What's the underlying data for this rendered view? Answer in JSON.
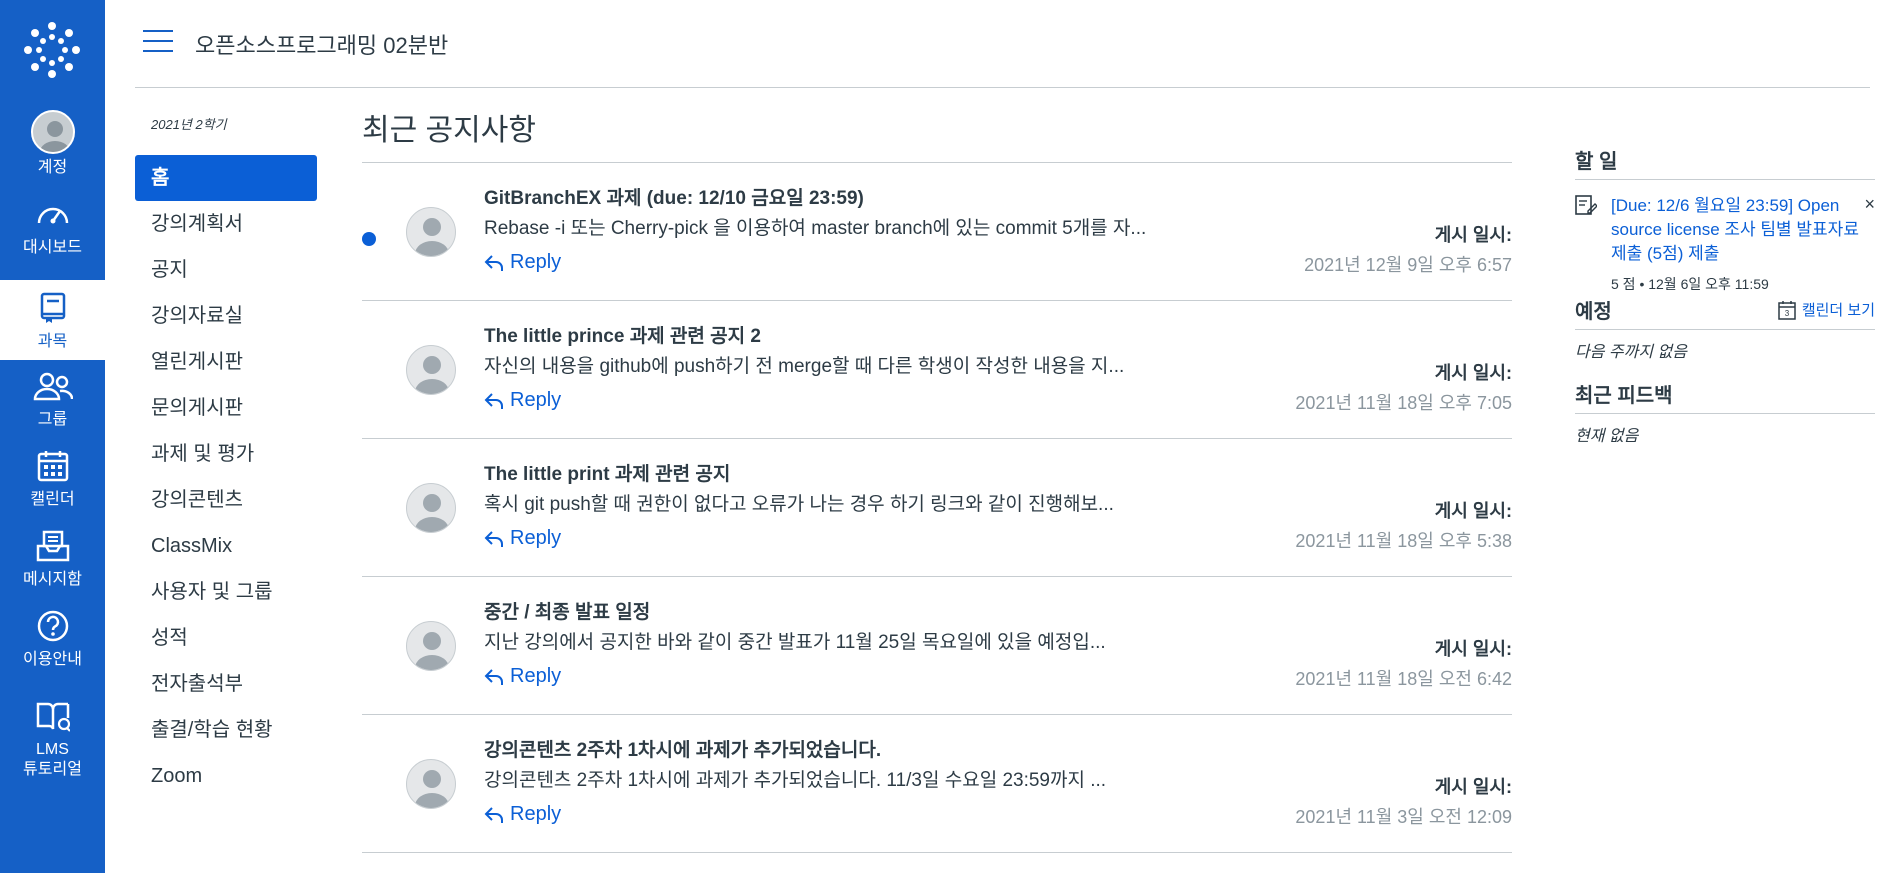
{
  "global_nav": {
    "items": [
      {
        "label": "계정",
        "icon": "avatar"
      },
      {
        "label": "대시보드",
        "icon": "dashboard-icon"
      },
      {
        "label": "과목",
        "icon": "courses-icon"
      },
      {
        "label": "그룹",
        "icon": "groups-icon"
      },
      {
        "label": "캘린더",
        "icon": "calendar-icon"
      },
      {
        "label": "메시지함",
        "icon": "inbox-icon"
      },
      {
        "label": "이용안내",
        "icon": "help-icon"
      },
      {
        "label": "LMS\n튜토리얼",
        "icon": "tutorial-icon"
      }
    ],
    "active_index": 2
  },
  "header": {
    "course_title": "오픈소스프로그래밍 02분반"
  },
  "course_nav": {
    "term": "2021년 2학기",
    "links": [
      "홈",
      "강의계획서",
      "공지",
      "강의자료실",
      "열린게시판",
      "문의게시판",
      "과제 및 평가",
      "강의콘텐츠",
      "ClassMix",
      "사용자 및 그룹",
      "성적",
      "전자출석부",
      "출결/학습 현황",
      "Zoom"
    ],
    "active_index": 0
  },
  "main": {
    "title": "최근 공지사항",
    "reply_label": "Reply",
    "posted_label": "게시 일시:",
    "announcements": [
      {
        "title": "GitBranchEX 과제 (due: 12/10 금요일 23:59)",
        "message": "Rebase -i 또는 Cherry-pick 을 이용하여 master branch에 있는 commit 5개를 자...",
        "date": "2021년 12월 9일 오후 6:57",
        "unread": true
      },
      {
        "title": "The little prince 과제 관련 공지 2",
        "message": "자신의 내용을 github에 push하기 전 merge할 때 다른 학생이 작성한 내용을 지...",
        "date": "2021년 11월 18일 오후 7:05",
        "unread": false
      },
      {
        "title": "The little print 과제 관련 공지",
        "message": "혹시 git push할 때 권한이 없다고 오류가 나는 경우 하기 링크와 같이 진행해보...",
        "date": "2021년 11월 18일 오후 5:38",
        "unread": false
      },
      {
        "title": "중간 / 최종 발표 일정",
        "message": "지난 강의에서 공지한 바와 같이 중간 발표가 11월 25일 목요일에 있을 예정입...",
        "date": "2021년 11월 18일 오전 6:42",
        "unread": false
      },
      {
        "title": "강의콘텐츠 2주차 1차시에 과제가 추가되었습니다.",
        "message": "강의콘텐츠 2주차 1차시에 과제가 추가되었습니다. 11/3일 수요일 23:59까지 ...",
        "date": "2021년 11월 3일 오전 12:09",
        "unread": false
      }
    ]
  },
  "sidebar": {
    "todo_heading": "할 일",
    "todo_item": {
      "link": "[Due: 12/6 월요일 23:59] Open source license 조사 팀별 발표자료 제출 (5점) 제출",
      "meta": "5 점 • 12월 6일 오후 11:59",
      "close": "×"
    },
    "upcoming_heading": "예정",
    "calendar_link": "캘린더 보기",
    "calendar_day": "3",
    "upcoming_empty": "다음 주까지 없음",
    "feedback_heading": "최근 피드백",
    "feedback_empty": "현재 없음"
  },
  "colors": {
    "nav_bg": "#1560c6",
    "accent": "#0b5fd6",
    "muted": "#8b969e"
  }
}
